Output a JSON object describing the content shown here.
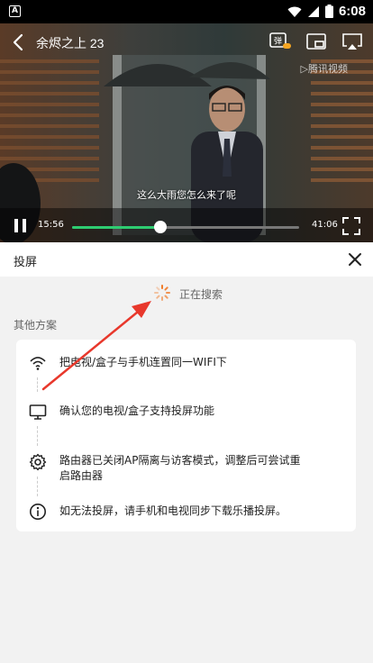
{
  "status_bar": {
    "app_badge": "A",
    "time": "6:08"
  },
  "player": {
    "title": "余烬之上 23",
    "watermark": "▷腾讯视频",
    "subtitle": "这么大雨您怎么来了呢",
    "time_current": "15:56",
    "time_total": "41:06",
    "progress": 0.39,
    "icons": [
      "back-icon",
      "danmaku-icon",
      "picture-in-picture-icon",
      "airplay-icon",
      "pause-icon",
      "fullscreen-icon"
    ]
  },
  "cast": {
    "title": "投屏",
    "searching_text": "正在搜索",
    "other_title": "其他方案",
    "steps": [
      {
        "icon": "wifi-icon",
        "text": "把电视/盒子与手机连置同一WIFI下"
      },
      {
        "icon": "tv-icon",
        "text": "确认您的电视/盒子支持投屏功能"
      },
      {
        "icon": "gear-icon",
        "text": "路由器已关闭AP隔离与访客模式，调整后可尝试重启路由器"
      },
      {
        "icon": "info-icon",
        "text": "如无法投屏，请手机和电视同步下载乐播投屏。"
      }
    ]
  },
  "colors": {
    "accent": "#2ecc71",
    "annotation": "#e8382c",
    "spinner": "#f07b2a"
  }
}
